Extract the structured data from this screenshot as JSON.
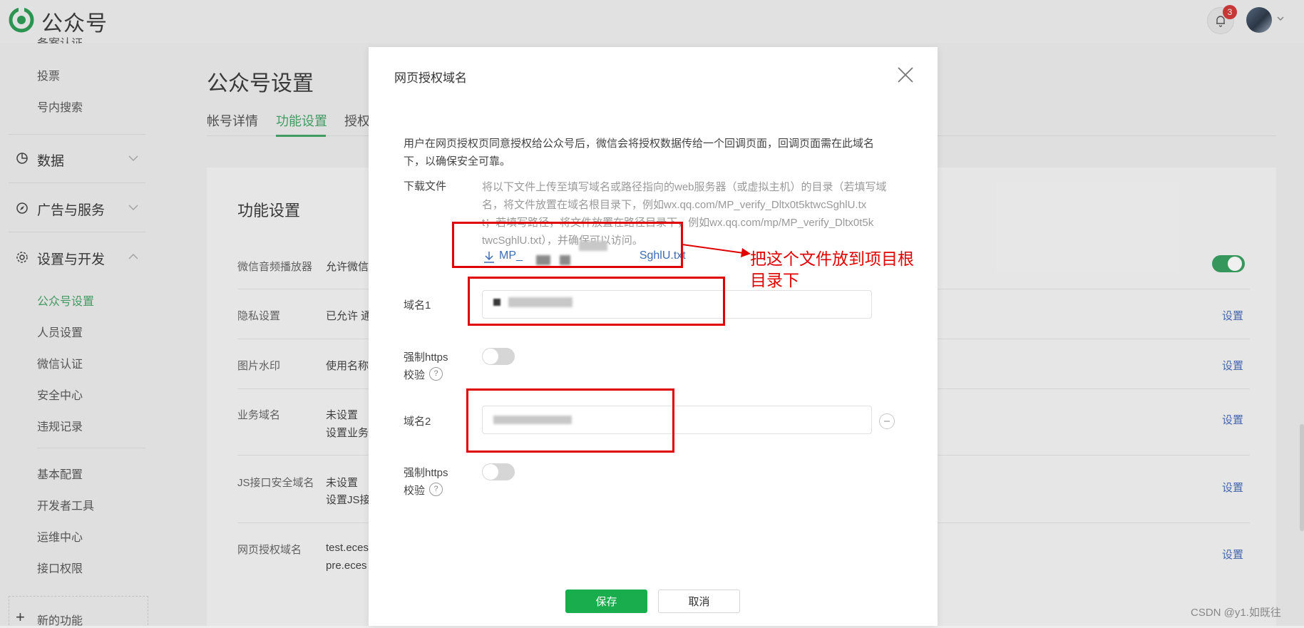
{
  "app": {
    "name": "公众号",
    "notification_count": "3"
  },
  "sidebar": {
    "top_partial": "备案认证",
    "items_a": [
      "投票",
      "号内搜索"
    ],
    "sections": [
      "数据",
      "广告与服务",
      "设置与开发"
    ],
    "settings_items": [
      "公众号设置",
      "人员设置",
      "微信认证",
      "安全中心",
      "违规记录"
    ],
    "dev_items": [
      "基本配置",
      "开发者工具",
      "运维中心",
      "接口权限"
    ],
    "new_feature": "新的功能"
  },
  "page": {
    "title": "公众号设置",
    "tabs": [
      "帐号详情",
      "功能设置",
      "授权"
    ],
    "card_title": "功能设置",
    "rows": [
      {
        "label": "微信音频播放器",
        "value": "允许微信",
        "action": ""
      },
      {
        "label": "隐私设置",
        "value": "已允许 通",
        "action": "设置"
      },
      {
        "label": "图片水印",
        "value": "使用名称",
        "action": "设置"
      },
      {
        "label": "业务域名",
        "value": "未设置",
        "value2": "设置业务",
        "action": "设置"
      },
      {
        "label": "JS接口安全域名",
        "value": "未设置",
        "value2": "设置JS接",
        "action": "设置"
      },
      {
        "label": "网页授权域名",
        "value": "test.eces",
        "value2": "pre.eces",
        "action": "设置"
      }
    ]
  },
  "dialog": {
    "title": "网页授权域名",
    "description": [
      "用户在网页授权页同意授权给公众号后，微信会将授权数据传给一个回调页面，回调页面需在此域名",
      "下，以确保安全可靠。"
    ],
    "download_label": "下载文件",
    "download_note": [
      "将以下文件上传至填写域名或路径指向的web服务器（或虚拟主机）的目录（若填写域",
      "名，将文件放置在域名根目录下，例如wx.qq.com/MP_verify_Dltx0t5ktwcSghlU.tx",
      "t；若填写路径，将文件放置在路径目录下，例如wx.qq.com/mp/MP_verify_Dltx0t5k",
      "twcSghlU.txt），并确保可以访问。"
    ],
    "download_file_prefix": "MP_",
    "download_file_suffix": "SghlU.txt",
    "domain1_label": "域名1",
    "domain2_label": "域名2",
    "https_label_1": "强制https",
    "https_label_2": "校验",
    "https_help": "?",
    "save": "保存",
    "cancel": "取消"
  },
  "annotation": {
    "text_line1": "把这个文件放到项目根",
    "text_line2": "目录下"
  },
  "watermark": "CSDN @y1.如既往"
}
